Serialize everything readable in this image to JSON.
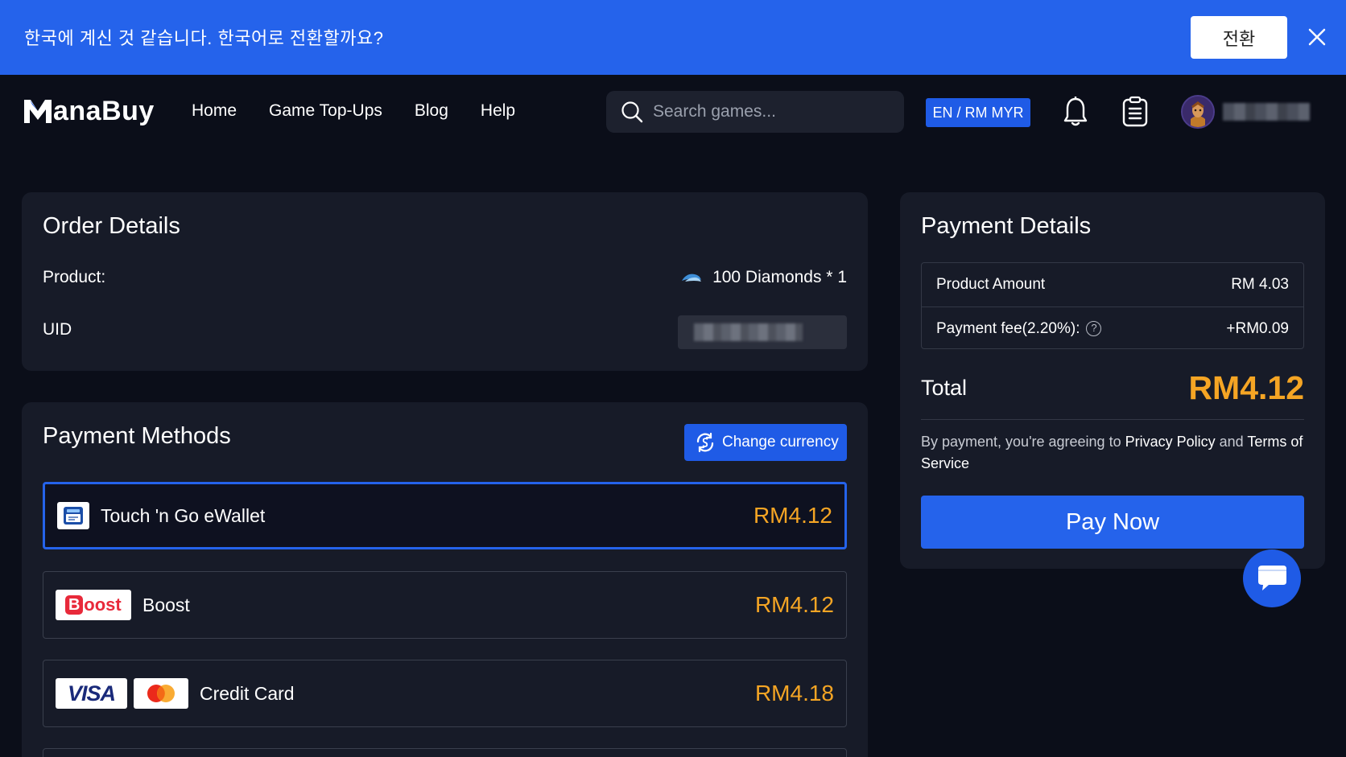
{
  "banner": {
    "message": "한국에 계신 것 같습니다. 한국어로 전환할까요?",
    "switch_label": "전환"
  },
  "header": {
    "brand": "ManaBuy",
    "brand_rest": "anaBuy",
    "nav": [
      "Home",
      "Game Top-Ups",
      "Blog",
      "Help"
    ],
    "search_placeholder": "Search games...",
    "lang_currency": "EN / RM MYR"
  },
  "order": {
    "title": "Order Details",
    "product_label": "Product:",
    "product_value": "100 Diamonds * 1",
    "uid_label": "UID"
  },
  "payment_methods": {
    "title": "Payment Methods",
    "change_currency_label": "Change currency",
    "items": [
      {
        "label": "Touch 'n Go eWallet",
        "price": "RM4.12",
        "selected": true
      },
      {
        "label": "Boost",
        "price": "RM4.12",
        "selected": false
      },
      {
        "label": "Credit Card",
        "price": "RM4.18",
        "selected": false
      }
    ],
    "visa_text": "VISA",
    "boost_text": "oost",
    "boost_b": "B"
  },
  "payment_details": {
    "title": "Payment Details",
    "product_amount_label": "Product Amount",
    "product_amount_value": "RM 4.03",
    "fee_label": "Payment fee(2.20%):",
    "fee_value": "+RM0.09",
    "total_label": "Total",
    "total_value": "RM4.12",
    "agree_prefix": "By payment, you're agreeing to ",
    "privacy": "Privacy Policy",
    "and": " and ",
    "terms": "Terms of Service",
    "pay_now": "Pay Now"
  },
  "colors": {
    "accent": "#2563eb",
    "price": "#f5a524",
    "background": "#0b0e19",
    "card": "#171b28"
  }
}
